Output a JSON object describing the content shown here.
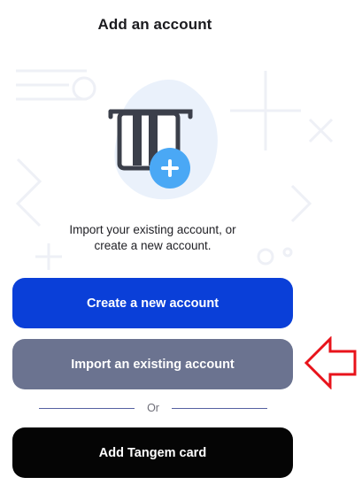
{
  "header": {
    "title": "Add an account"
  },
  "illustration": {
    "icon": "card-slot-add-icon",
    "accent": "#4aa8f5"
  },
  "description": {
    "line1": "Import your existing account, or",
    "line2": "create a new account."
  },
  "buttons": {
    "create": "Create a new account",
    "import": "Import an existing account",
    "card": "Add Tangem card"
  },
  "divider": {
    "label": "Or"
  },
  "colors": {
    "primary": "#0a3fd8",
    "secondary": "#6b7390",
    "dark": "#050505",
    "annotation": "#e8131b"
  }
}
